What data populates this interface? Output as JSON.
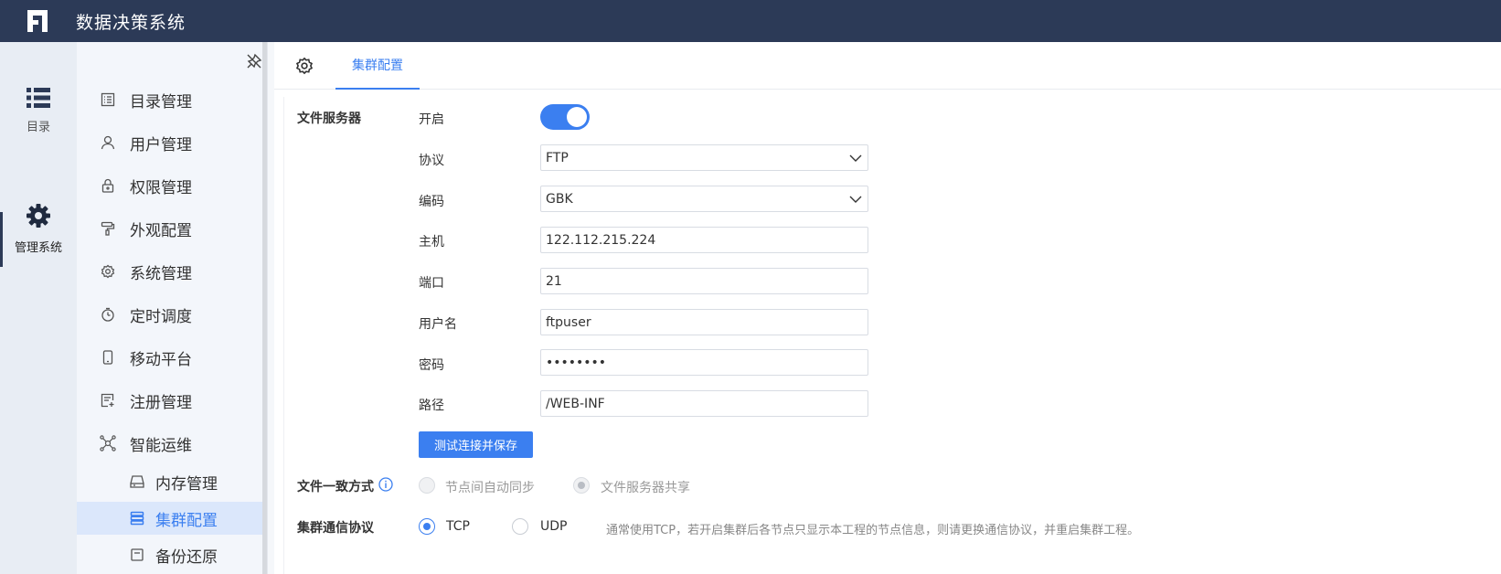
{
  "app": {
    "title": "数据决策系统"
  },
  "rail": {
    "items": [
      {
        "label": "目录",
        "icon": "list-icon"
      },
      {
        "label": "管理系统",
        "icon": "gear-icon"
      }
    ]
  },
  "sidebar": {
    "items": [
      {
        "label": "目录管理",
        "icon": "catalog-icon"
      },
      {
        "label": "用户管理",
        "icon": "user-icon"
      },
      {
        "label": "权限管理",
        "icon": "lock-icon"
      },
      {
        "label": "外观配置",
        "icon": "paint-roller-icon"
      },
      {
        "label": "系统管理",
        "icon": "settings-icon"
      },
      {
        "label": "定时调度",
        "icon": "timer-icon"
      },
      {
        "label": "移动平台",
        "icon": "mobile-icon"
      },
      {
        "label": "注册管理",
        "icon": "register-icon"
      },
      {
        "label": "智能运维",
        "icon": "network-icon"
      }
    ],
    "subitems": [
      {
        "label": "内存管理",
        "icon": "memory-icon"
      },
      {
        "label": "集群配置",
        "icon": "cluster-icon",
        "active": true
      },
      {
        "label": "备份还原",
        "icon": "backup-icon"
      }
    ]
  },
  "tabs": [
    {
      "label": "集群配置",
      "active": true
    }
  ],
  "file_server": {
    "section_label": "文件服务器",
    "enable_label": "开启",
    "enabled": true,
    "protocol_label": "协议",
    "protocol_value": "FTP",
    "encoding_label": "编码",
    "encoding_value": "GBK",
    "host_label": "主机",
    "host_value": "122.112.215.224",
    "port_label": "端口",
    "port_value": "21",
    "username_label": "用户名",
    "username_value": "ftpuser",
    "password_label": "密码",
    "password_value": "••••••••",
    "path_label": "路径",
    "path_value": "/WEB-INF",
    "test_button": "测试连接并保存"
  },
  "consistency": {
    "section_label": "文件一致方式",
    "option_auto": "节点间自动同步",
    "option_shared": "文件服务器共享",
    "selected": "文件服务器共享"
  },
  "communication": {
    "section_label": "集群通信协议",
    "option_tcp": "TCP",
    "option_udp": "UDP",
    "selected": "TCP",
    "hint": "通常使用TCP，若开启集群后各节点只显示本工程的节点信息，则请更换通信协议，并重启集群工程。"
  },
  "colors": {
    "topbar": "#2c3a57",
    "accent": "#3b7ff0"
  }
}
